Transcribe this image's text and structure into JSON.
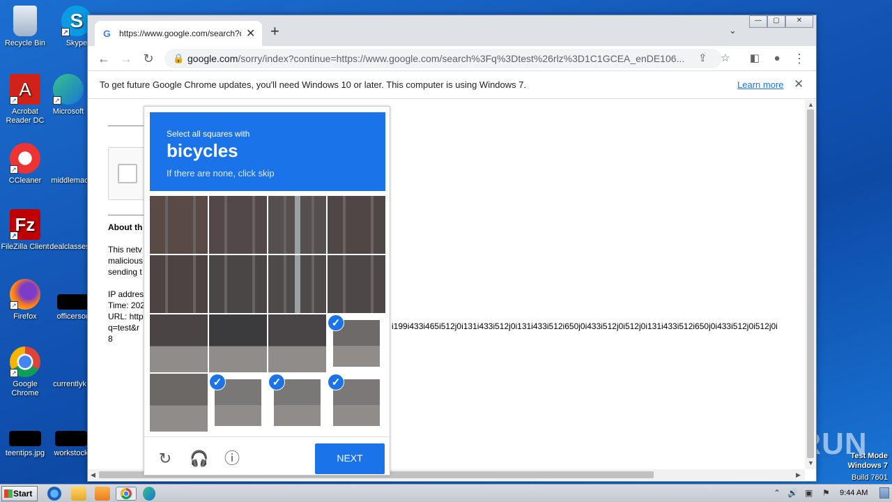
{
  "desktop": {
    "icons": [
      {
        "label": "Recycle Bin"
      },
      {
        "label": "Skype"
      },
      {
        "label": "Acrobat Reader DC"
      },
      {
        "label": "Microsoft"
      },
      {
        "label": "CCleaner"
      },
      {
        "label": "middlemac"
      },
      {
        "label": "FileZilla Client"
      },
      {
        "label": "dealclasses"
      },
      {
        "label": "Firefox"
      },
      {
        "label": "officersoc"
      },
      {
        "label": "Google Chrome"
      },
      {
        "label": "currentlyk"
      },
      {
        "label": "teentips.jpg"
      },
      {
        "label": "workstock"
      }
    ]
  },
  "browser": {
    "tab_title": "https://www.google.com/search?q=",
    "url_domain": "google.com",
    "url_rest": "/sorry/index?continue=https://www.google.com/search%3Fq%3Dtest%26rlz%3D1C1GCEA_enDE106...",
    "infobar_message": "To get future Google Chrome updates, you'll need Windows 10 or later. This computer is using Windows 7.",
    "infobar_link": "Learn more"
  },
  "page": {
    "about_heading": "About th",
    "para_lines": [
      "This netv",
      "malicious",
      "sending t"
    ],
    "info_lines": [
      "IP addres",
      "Time: 202",
      "URL: http",
      "q=test&r",
      "8"
    ],
    "url_fragment": "i199i433i465i512j0i131i433i512j0i131i433i512i650j0i433i512j0i512j0i131i433i512i650j0i433i512j0i512j0i"
  },
  "captcha": {
    "instruction": "Select all squares with",
    "target": "bicycles",
    "hint": "If there are none, click skip",
    "next_label": "NEXT",
    "selected_cells": [
      11,
      13,
      14,
      15
    ]
  },
  "taskbar": {
    "start_label": "Start",
    "clock": "9:44 AM"
  },
  "overlay": {
    "watermark": "ANY RUN",
    "test_mode": "Test Mode",
    "os": "Windows 7",
    "build": "Build 7601"
  }
}
